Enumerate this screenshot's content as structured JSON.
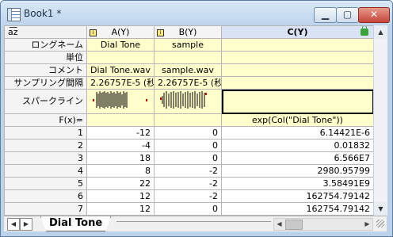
{
  "window": {
    "title": "Book1 *",
    "min_label": "▁",
    "max_label": "▢",
    "close_label": "✕"
  },
  "corner_label": "a͞z",
  "columns": [
    {
      "label": "A(Y)",
      "icon": "column-header-icon"
    },
    {
      "label": "B(Y)",
      "icon": "column-header-icon"
    },
    {
      "label": "C(Y)",
      "icon": "lock-icon",
      "selected": true
    }
  ],
  "row_labels": {
    "long_name": "ロングネーム",
    "units": "単位",
    "comments": "コメント",
    "sampling": "サンプリング間隔",
    "sparkline": "スパークライン",
    "fx": "F(x)="
  },
  "meta": {
    "long_name": [
      "Dial Tone",
      "sample",
      ""
    ],
    "units": [
      "",
      "",
      ""
    ],
    "comments": [
      "Dial Tone.wav",
      "sample.wav",
      ""
    ],
    "sampling": [
      "2.26757E-5 (秒)",
      "2.26757E-5 (秒)",
      ""
    ],
    "fx": [
      "",
      "",
      "exp(Col(\"Dial Tone\"))"
    ]
  },
  "rows": [
    {
      "index": "1",
      "a": "-12",
      "b": "0",
      "c": "6.14421E-6"
    },
    {
      "index": "2",
      "a": "-4",
      "b": "0",
      "c": "0.01832"
    },
    {
      "index": "3",
      "a": "18",
      "b": "0",
      "c": "6.566E7"
    },
    {
      "index": "4",
      "a": "8",
      "b": "-2",
      "c": "2980.95799"
    },
    {
      "index": "5",
      "a": "22",
      "b": "-2",
      "c": "3.58491E9"
    },
    {
      "index": "6",
      "a": "12",
      "b": "-2",
      "c": "162754.79142"
    },
    {
      "index": "7",
      "a": "12",
      "b": "0",
      "c": "162754.79142"
    }
  ],
  "sheet_tab": {
    "label": "Dial Tone"
  },
  "colors": {
    "header_yellow": "#ffffcc",
    "selected_col": "#d9e3f5",
    "title_bar": "#c9dcef"
  }
}
